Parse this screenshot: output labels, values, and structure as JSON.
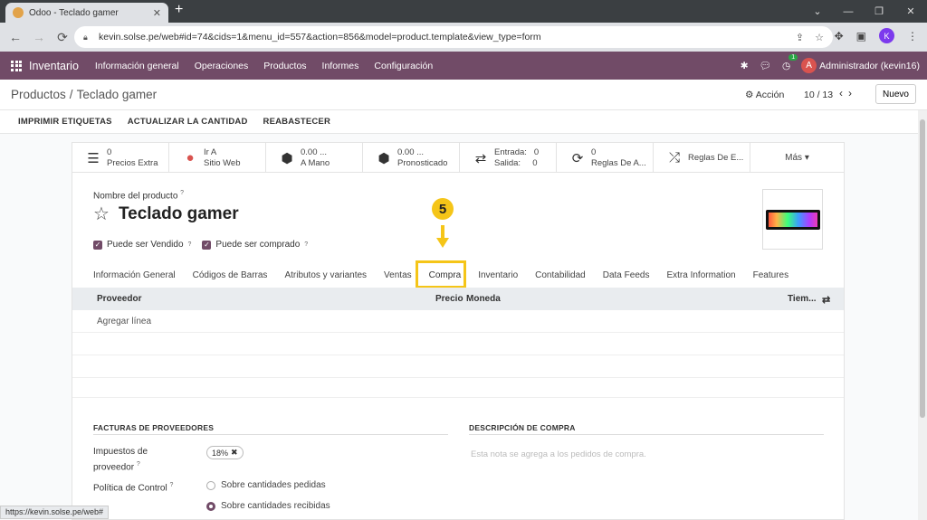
{
  "browser": {
    "tab_title": "Odoo - Teclado gamer",
    "url": "kevin.solse.pe/web#id=74&cids=1&menu_id=557&action=856&model=product.template&view_type=form",
    "status_url": "https://kevin.solse.pe/web#",
    "profile_initial": "K"
  },
  "navbar": {
    "app": "Inventario",
    "menu": [
      "Información general",
      "Operaciones",
      "Productos",
      "Informes",
      "Configuración"
    ],
    "activity_count": "1",
    "user_initial": "A",
    "user": "Administrador (kevin16)"
  },
  "control": {
    "breadcrumb_root": "Productos",
    "breadcrumb_current": "Teclado gamer",
    "action": "Acción",
    "pager": "10 / 13",
    "new_button": "Nuevo"
  },
  "status_buttons": [
    "IMPRIMIR ETIQUETAS",
    "ACTUALIZAR LA CANTIDAD",
    "REABASTECER"
  ],
  "smart_buttons": [
    {
      "icon": "list-icon",
      "glyph": "☰",
      "line1": "0",
      "line2": "Precios Extra"
    },
    {
      "icon": "globe-icon",
      "glyph": "●",
      "line1": "Ir A",
      "line2": "Sitio Web"
    },
    {
      "icon": "cubes-icon",
      "glyph": "⬢",
      "line1": "0.00 ...",
      "line2": "A Mano"
    },
    {
      "icon": "cubes-icon",
      "glyph": "⬢",
      "line1": "0.00 ...",
      "line2": "Pronosticado"
    },
    {
      "icon": "exchange-icon",
      "glyph": "⇄",
      "line1": "Entrada:   0",
      "line2": "Salida:     0"
    },
    {
      "icon": "refresh-icon",
      "glyph": "⟳",
      "line1": "0",
      "line2": "Reglas De A..."
    },
    {
      "icon": "shuffle-icon",
      "glyph": "⤮",
      "line1": "Reglas De E...",
      "line2": ""
    }
  ],
  "more_button": "Más",
  "product": {
    "name_label": "Nombre del producto",
    "name": "Teclado gamer",
    "can_sell_label": "Puede ser Vendido",
    "can_buy_label": "Puede ser comprado"
  },
  "annotation": {
    "step": "5"
  },
  "tabs": [
    "Información General",
    "Códigos de Barras",
    "Atributos y variantes",
    "Ventas",
    "Compra",
    "Inventario",
    "Contabilidad",
    "Data Feeds",
    "Extra Information",
    "Features"
  ],
  "active_tab": "Compra",
  "vendor_table": {
    "columns": [
      "Proveedor",
      "Precio",
      "Moneda",
      "Tiem..."
    ],
    "add_line": "Agregar línea"
  },
  "purchase": {
    "invoices_header": "FACTURAS DE PROVEEDORES",
    "description_header": "DESCRIPCIÓN DE COMPRA",
    "taxes_label_1": "Impuestos de",
    "taxes_label_2": "proveedor",
    "tax_tag": "18%",
    "control_policy_label": "Política de Control",
    "policy_ordered": "Sobre cantidades pedidas",
    "policy_received": "Sobre cantidades recibidas",
    "description_placeholder": "Esta nota se agrega a los pedidos de compra."
  },
  "colors": {
    "brand": "#714b67",
    "highlight": "#f5c518"
  }
}
